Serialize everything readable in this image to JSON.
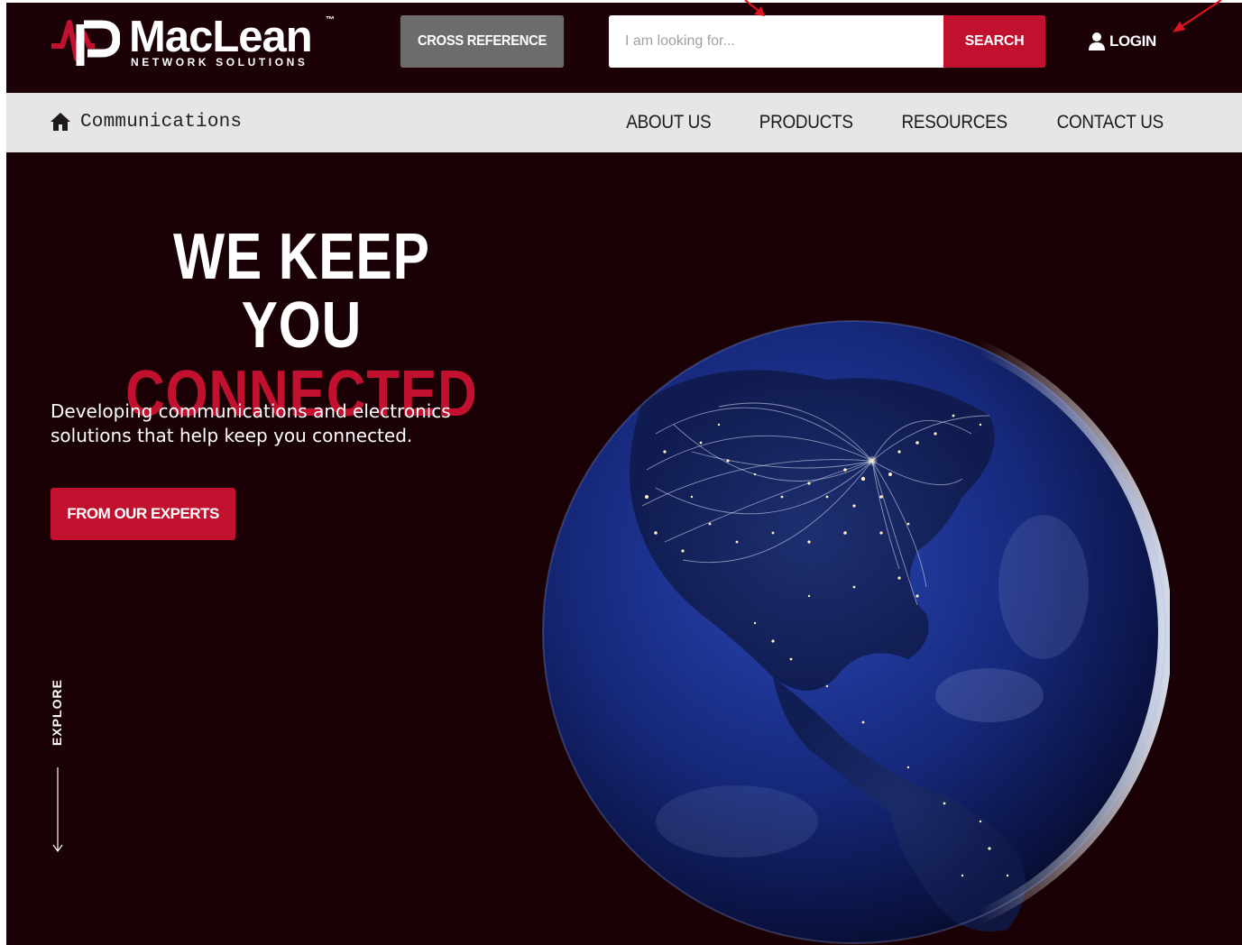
{
  "header": {
    "logo_word": "MacLean",
    "logo_tm": "™",
    "logo_sub": "NETWORK SOLUTIONS",
    "cross_reference_label": "CROSS REFERENCE",
    "search_placeholder": "I am looking for...",
    "search_label": "SEARCH",
    "login_label": "LOGIN"
  },
  "nav": {
    "breadcrumb": "Communications",
    "links": [
      "ABOUT US",
      "PRODUCTS",
      "RESOURCES",
      "CONTACT US"
    ]
  },
  "hero": {
    "headline_line1": "WE KEEP YOU",
    "headline_line2": "CONNECTED",
    "tagline": "Developing communications and electronics solutions that help keep you connected.",
    "cta_label": "FROM OUR EXPERTS",
    "explore_label": "EXPLORE"
  },
  "colors": {
    "background": "#1a0105",
    "accent_red": "#c2102f",
    "nav_bg": "#e6e6e6",
    "cross_ref_bg": "#6e6b6c",
    "globe_blue": "#1a2f8a"
  },
  "icons": [
    "logo-mark-icon",
    "user-icon",
    "home-icon",
    "arrow-down-icon"
  ]
}
